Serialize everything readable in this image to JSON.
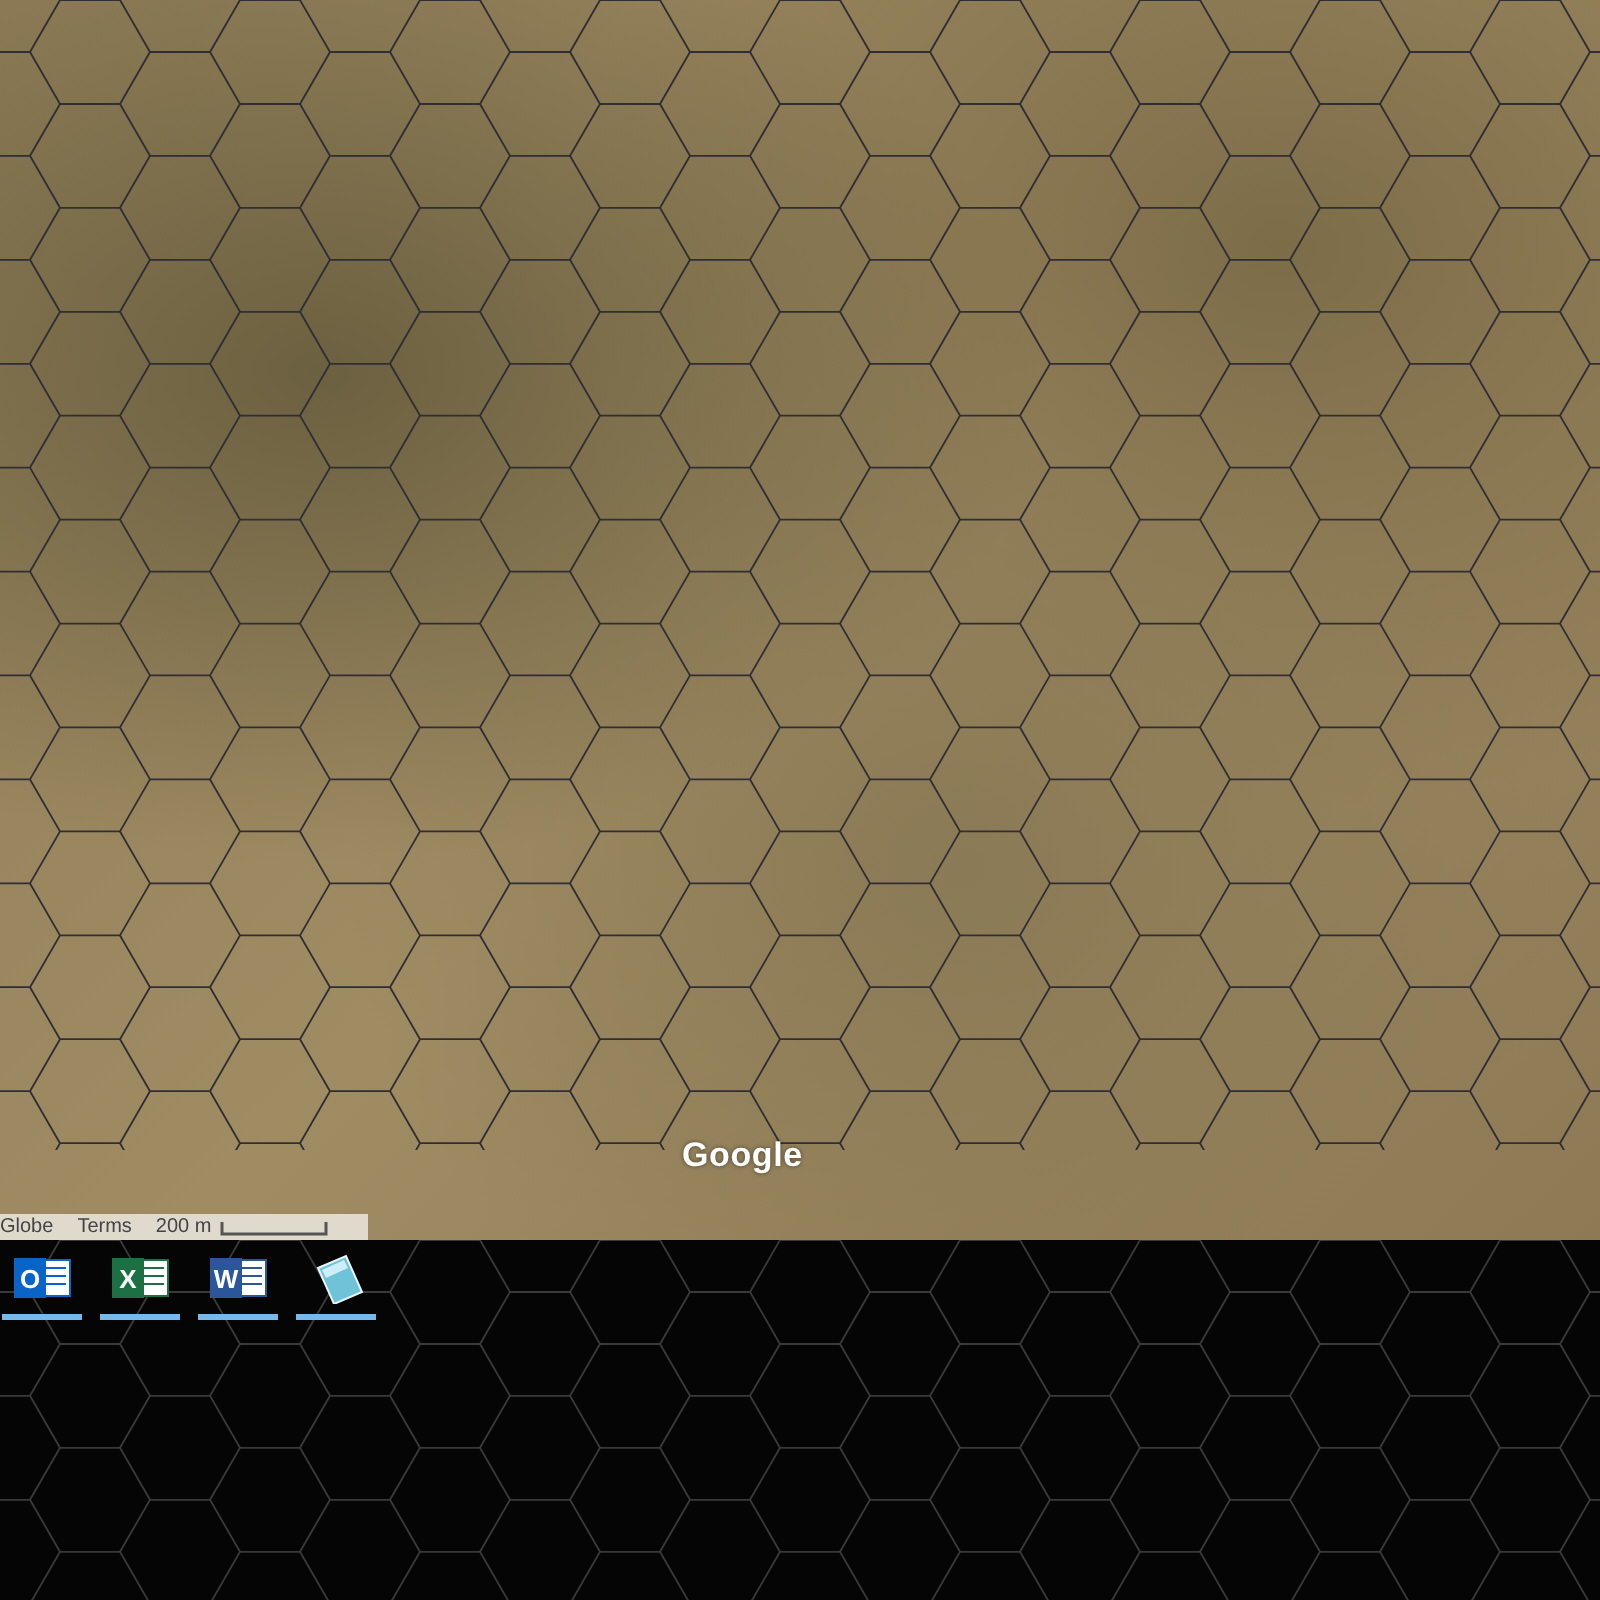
{
  "map": {
    "logo": "Google",
    "attribution": {
      "items": [
        "Globe",
        "Terms"
      ],
      "scale_label": "200 m"
    }
  },
  "taskbar": {
    "apps": [
      {
        "kind": "mail",
        "glyph": "O",
        "running": true
      },
      {
        "kind": "sheet",
        "glyph": "X",
        "running": true
      },
      {
        "kind": "doc",
        "glyph": "W",
        "running": true
      },
      {
        "kind": "notepad",
        "running": true
      }
    ]
  }
}
